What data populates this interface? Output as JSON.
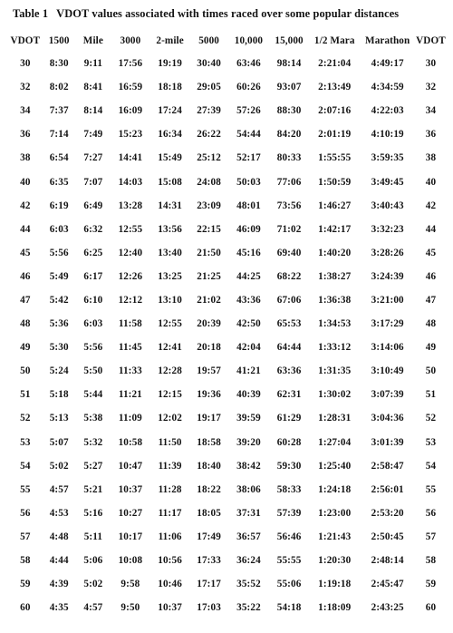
{
  "caption": {
    "label": "Table 1",
    "text": "VDOT values associated with times raced over some popular distances"
  },
  "table": {
    "headers": [
      "VDOT",
      "1500",
      "Mile",
      "3000",
      "2-mile",
      "5000",
      "10,000",
      "15,000",
      "1/2 Mara",
      "Marathon",
      "VDOT"
    ],
    "rows": [
      [
        "30",
        "8:30",
        "9:11",
        "17:56",
        "19:19",
        "30:40",
        "63:46",
        "98:14",
        "2:21:04",
        "4:49:17",
        "30"
      ],
      [
        "32",
        "8:02",
        "8:41",
        "16:59",
        "18:18",
        "29:05",
        "60:26",
        "93:07",
        "2:13:49",
        "4:34:59",
        "32"
      ],
      [
        "34",
        "7:37",
        "8:14",
        "16:09",
        "17:24",
        "27:39",
        "57:26",
        "88:30",
        "2:07:16",
        "4:22:03",
        "34"
      ],
      [
        "36",
        "7:14",
        "7:49",
        "15:23",
        "16:34",
        "26:22",
        "54:44",
        "84:20",
        "2:01:19",
        "4:10:19",
        "36"
      ],
      [
        "38",
        "6:54",
        "7:27",
        "14:41",
        "15:49",
        "25:12",
        "52:17",
        "80:33",
        "1:55:55",
        "3:59:35",
        "38"
      ],
      [
        "40",
        "6:35",
        "7:07",
        "14:03",
        "15:08",
        "24:08",
        "50:03",
        "77:06",
        "1:50:59",
        "3:49:45",
        "40"
      ],
      [
        "42",
        "6:19",
        "6:49",
        "13:28",
        "14:31",
        "23:09",
        "48:01",
        "73:56",
        "1:46:27",
        "3:40:43",
        "42"
      ],
      [
        "44",
        "6:03",
        "6:32",
        "12:55",
        "13:56",
        "22:15",
        "46:09",
        "71:02",
        "1:42:17",
        "3:32:23",
        "44"
      ],
      [
        "45",
        "5:56",
        "6:25",
        "12:40",
        "13:40",
        "21:50",
        "45:16",
        "69:40",
        "1:40:20",
        "3:28:26",
        "45"
      ],
      [
        "46",
        "5:49",
        "6:17",
        "12:26",
        "13:25",
        "21:25",
        "44:25",
        "68:22",
        "1:38:27",
        "3:24:39",
        "46"
      ],
      [
        "47",
        "5:42",
        "6:10",
        "12:12",
        "13:10",
        "21:02",
        "43:36",
        "67:06",
        "1:36:38",
        "3:21:00",
        "47"
      ],
      [
        "48",
        "5:36",
        "6:03",
        "11:58",
        "12:55",
        "20:39",
        "42:50",
        "65:53",
        "1:34:53",
        "3:17:29",
        "48"
      ],
      [
        "49",
        "5:30",
        "5:56",
        "11:45",
        "12:41",
        "20:18",
        "42:04",
        "64:44",
        "1:33:12",
        "3:14:06",
        "49"
      ],
      [
        "50",
        "5:24",
        "5:50",
        "11:33",
        "12:28",
        "19:57",
        "41:21",
        "63:36",
        "1:31:35",
        "3:10:49",
        "50"
      ],
      [
        "51",
        "5:18",
        "5:44",
        "11:21",
        "12:15",
        "19:36",
        "40:39",
        "62:31",
        "1:30:02",
        "3:07:39",
        "51"
      ],
      [
        "52",
        "5:13",
        "5:38",
        "11:09",
        "12:02",
        "19:17",
        "39:59",
        "61:29",
        "1:28:31",
        "3:04:36",
        "52"
      ],
      [
        "53",
        "5:07",
        "5:32",
        "10:58",
        "11:50",
        "18:58",
        "39:20",
        "60:28",
        "1:27:04",
        "3:01:39",
        "53"
      ],
      [
        "54",
        "5:02",
        "5:27",
        "10:47",
        "11:39",
        "18:40",
        "38:42",
        "59:30",
        "1:25:40",
        "2:58:47",
        "54"
      ],
      [
        "55",
        "4:57",
        "5:21",
        "10:37",
        "11:28",
        "18:22",
        "38:06",
        "58:33",
        "1:24:18",
        "2:56:01",
        "55"
      ],
      [
        "56",
        "4:53",
        "5:16",
        "10:27",
        "11:17",
        "18:05",
        "37:31",
        "57:39",
        "1:23:00",
        "2:53:20",
        "56"
      ],
      [
        "57",
        "4:48",
        "5:11",
        "10:17",
        "11:06",
        "17:49",
        "36:57",
        "56:46",
        "1:21:43",
        "2:50:45",
        "57"
      ],
      [
        "58",
        "4:44",
        "5:06",
        "10:08",
        "10:56",
        "17:33",
        "36:24",
        "55:55",
        "1:20:30",
        "2:48:14",
        "58"
      ],
      [
        "59",
        "4:39",
        "5:02",
        "9:58",
        "10:46",
        "17:17",
        "35:52",
        "55:06",
        "1:19:18",
        "2:45:47",
        "59"
      ],
      [
        "60",
        "4:35",
        "4:57",
        "9:50",
        "10:37",
        "17:03",
        "35:22",
        "54:18",
        "1:18:09",
        "2:43:25",
        "60"
      ]
    ]
  }
}
